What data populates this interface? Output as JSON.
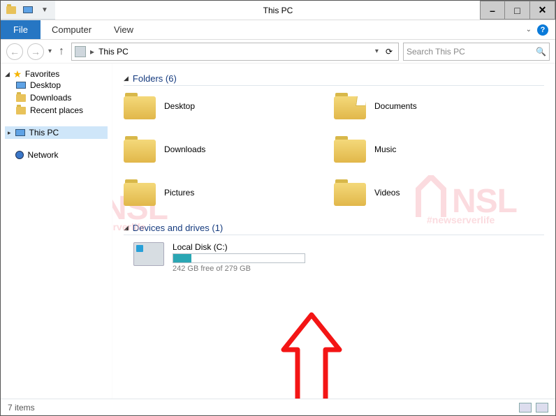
{
  "window": {
    "title": "This PC",
    "qat": [
      "folder-prop-icon",
      "new-window-icon",
      "dropdown-icon"
    ]
  },
  "window_controls": {
    "min": "–",
    "max": "□",
    "close": "✕"
  },
  "ribbon": {
    "file": "File",
    "tabs": [
      "Computer",
      "View"
    ],
    "help": "?"
  },
  "nav": {
    "back": "←",
    "forward": "→",
    "down": "▾",
    "up": "↑",
    "refresh": "⟳"
  },
  "address": {
    "label": "This PC",
    "dropdown": "▾"
  },
  "search": {
    "placeholder": "Search This PC"
  },
  "sidebar": {
    "fav_header": "Favorites",
    "fav_items": [
      {
        "label": "Desktop"
      },
      {
        "label": "Downloads"
      },
      {
        "label": "Recent places"
      }
    ],
    "pc_header": "This PC",
    "net_header": "Network"
  },
  "content": {
    "folders_header": "Folders (6)",
    "devices_header": "Devices and drives (1)",
    "folders": [
      {
        "label": "Desktop"
      },
      {
        "label": "Documents"
      },
      {
        "label": "Downloads"
      },
      {
        "label": "Music"
      },
      {
        "label": "Pictures"
      },
      {
        "label": "Videos"
      }
    ],
    "drive": {
      "label": "Local Disk (C:)",
      "sub": "242 GB free of 279 GB",
      "fill_percent": 14
    }
  },
  "status": {
    "items": "7 items"
  },
  "watermark": {
    "big": "NSL",
    "small": "#newserverlife"
  }
}
